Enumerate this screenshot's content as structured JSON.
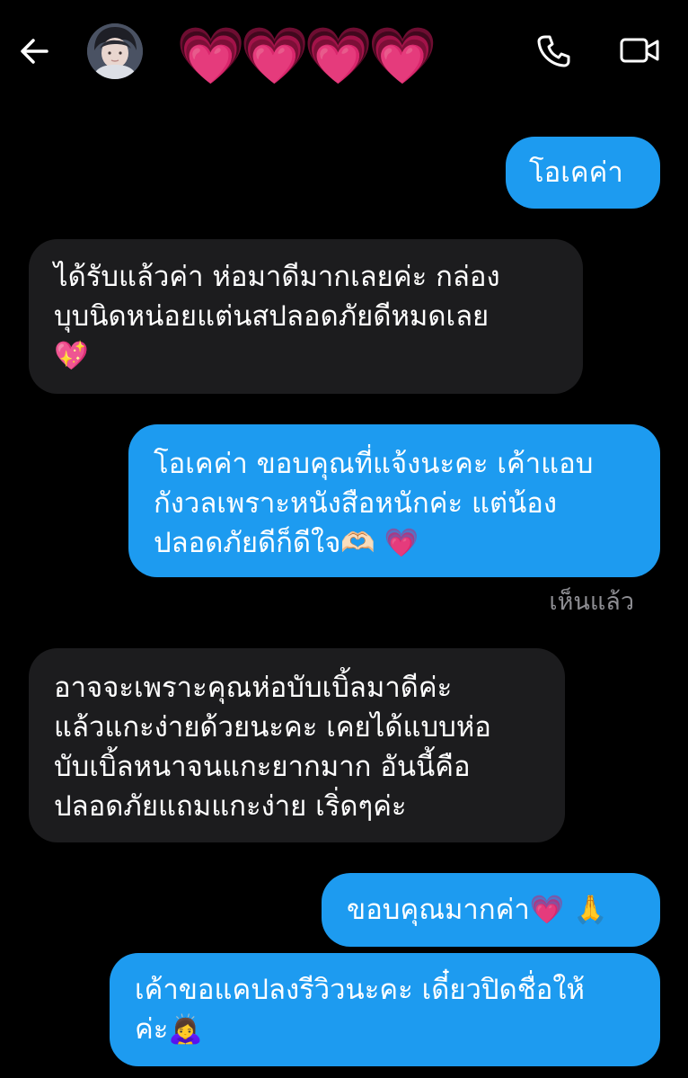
{
  "header": {
    "back_label": "Back",
    "contact_name": "💗💗💗💗",
    "call_label": "Voice call",
    "video_label": "Video call"
  },
  "messages": [
    {
      "direction": "outgoing",
      "text": "โอเคค่า"
    },
    {
      "direction": "incoming",
      "text": "ได้รับแล้วค่า ห่อมาดีมากเลยค่ะ กล่อง\nบุบนิดหน่อยแต่นสปลอดภัยดีหมดเลย\n💖"
    },
    {
      "direction": "outgoing",
      "text": "โอเคค่า ขอบคุณที่แจ้งนะคะ เค้าแอบ\nกังวลเพราะหนังสือหนักค่ะ แต่น้อง\nปลอดภัยดีก็ดีใจ🫶🏻 💗"
    },
    {
      "direction": "incoming",
      "text": "อาจจะเพราะคุณห่อบับเบิ้ลมาดีค่ะ\nแล้วแกะง่ายด้วยนะคะ เคยได้แบบห่อ\nบับเบิ้ลหนาจนแกะยากมาก อันนี้คือ\nปลอดภัยแถมแกะง่าย เริ่ดๆค่ะ"
    },
    {
      "direction": "outgoing",
      "text": "ขอบคุณมากค่า💗 🙏"
    },
    {
      "direction": "outgoing",
      "text": "เค้าขอแคปลงรีวิวนะคะ เดี๋ยวปิดชื่อให้\nค่ะ🙇‍♀️"
    }
  ],
  "seen_status": "เห็นแล้ว",
  "colors": {
    "background": "#000000",
    "outgoing_bubble": "#1d9bf0",
    "incoming_bubble": "#1c1c1e",
    "seen_text": "#8e8e93"
  },
  "icons": [
    "arrow-left-icon",
    "avatar",
    "phone-icon",
    "video-camera-icon"
  ]
}
